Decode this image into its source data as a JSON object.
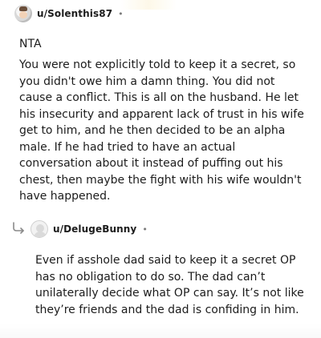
{
  "comments": [
    {
      "username": "u/Solenthis87",
      "separator": "•",
      "lines": [
        "NTA",
        "You were not explicitly told to keep it a secret, so you didn't owe him a damn thing. You did not cause a conflict. This is all on the husband. He let his insecurity and apparent lack of trust in his wife get to him, and he then decided to be an alpha male. If he had tried to have an actual conversation about it instead of puffing out his chest, then maybe the fight with his wife wouldn't have happened."
      ],
      "avatar_icon": "user-avatar-icon"
    },
    {
      "username": "u/DelugeBunny",
      "separator": "•",
      "body": "Even if asshole dad said to keep it a secret OP has no obligation to do so. The dad can’t unilaterally decide what OP can say. It’s not like they’re friends and the dad is confiding in him.",
      "avatar_icon": "default-avatar-icon",
      "reply_icon": "reply-arrow-icon"
    }
  ],
  "colors": {
    "text": "#1c1c1c",
    "meta": "#7c7c7c",
    "reply_icon": "#8a8a8a"
  }
}
